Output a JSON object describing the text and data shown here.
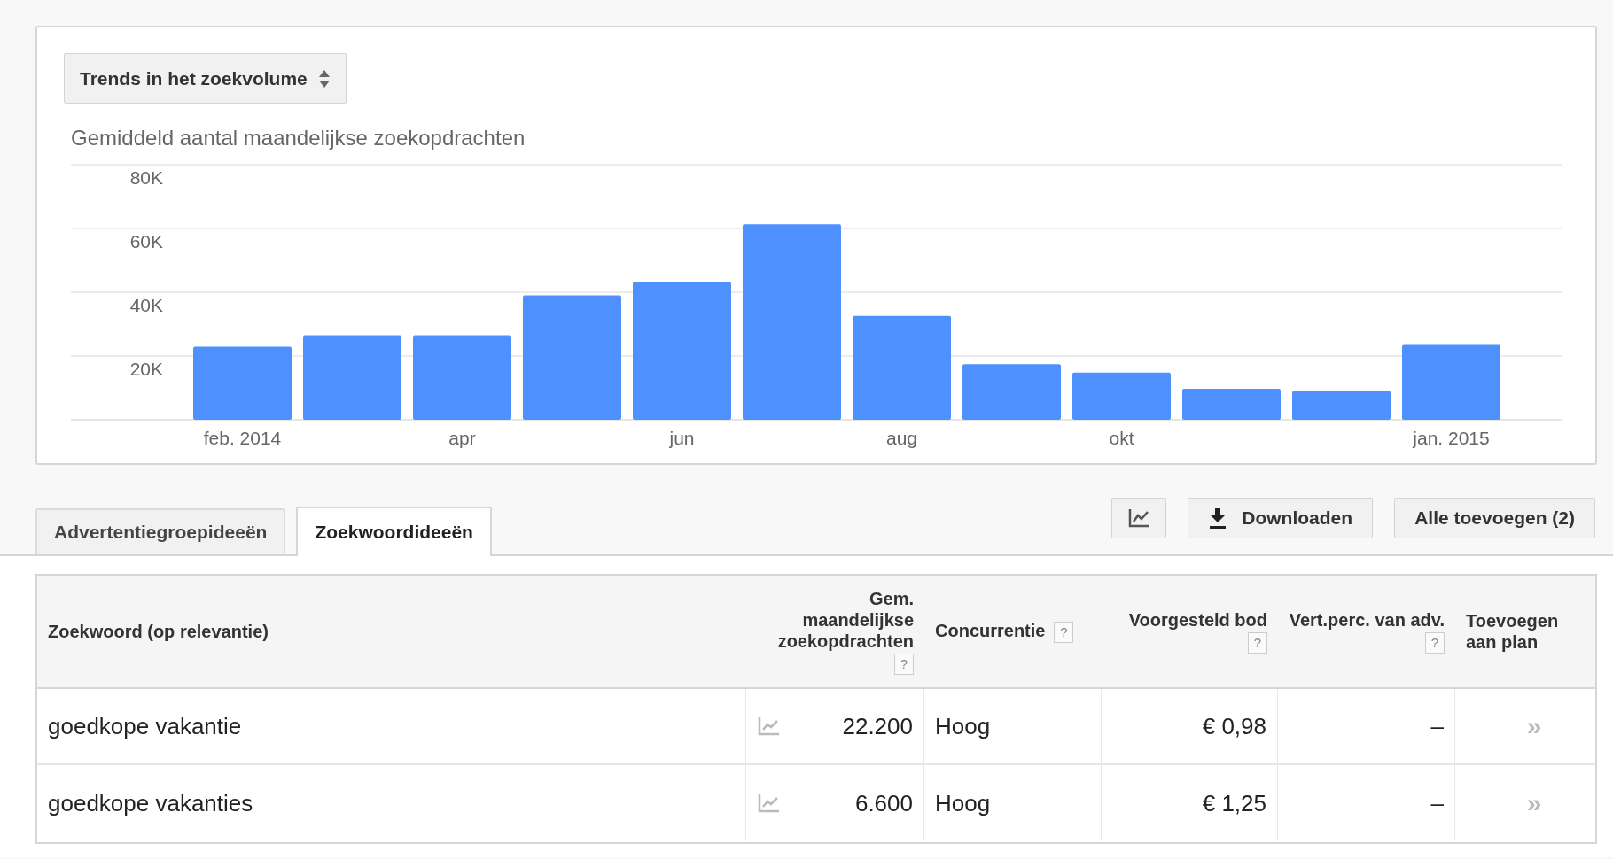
{
  "selector": {
    "label": "Trends in het zoekvolume"
  },
  "chart": {
    "title": "Gemiddeld aantal maandelijkse zoekopdrachten",
    "chart_data": {
      "type": "bar",
      "grid": true,
      "categories": [
        "feb. 2014",
        null,
        "apr",
        null,
        "jun",
        null,
        "aug",
        null,
        "okt",
        null,
        null,
        "jan. 2015"
      ],
      "series": [
        {
          "color": "#4d90fe",
          "values": [
            22900,
            26500,
            26500,
            39000,
            43200,
            61300,
            32600,
            17400,
            14800,
            9700,
            9000,
            23500
          ]
        }
      ],
      "ylim": [
        0,
        80000
      ],
      "yticks": [
        {
          "value": 20000,
          "label": "20K"
        },
        {
          "value": 40000,
          "label": "40K"
        },
        {
          "value": 60000,
          "label": "60K"
        },
        {
          "value": 80000,
          "label": "80K"
        }
      ]
    }
  },
  "tabs": [
    {
      "label": "Advertentiegroepideeën",
      "selected": false
    },
    {
      "label": "Zoekwoordideeën",
      "selected": true
    }
  ],
  "toolbar": [
    {
      "kind": "chart"
    },
    {
      "kind": "download",
      "label": "Downloaden"
    },
    {
      "kind": "text",
      "label": "Alle toevoegen (2)"
    }
  ],
  "table": {
    "columns": [
      {
        "label": "Zoekwoord (op relevantie)"
      },
      {
        "label": "Gem. maandelijkse zoekopdrachten",
        "help": "?"
      },
      {
        "label": "Concurrentie",
        "help": "?"
      },
      {
        "label": "Voorgesteld bod",
        "help": "?"
      },
      {
        "label": "Vert.perc. van adv.",
        "help": "?"
      },
      {
        "label": "Toevoegen aan plan"
      }
    ],
    "rows": [
      {
        "keyword": "goedkope vakantie",
        "volume": "22.200",
        "competition": "Hoog",
        "bid": "€ 0,98",
        "share": "–",
        "add": "»"
      },
      {
        "keyword": "goedkope vakanties",
        "volume": "6.600",
        "competition": "Hoog",
        "bid": "€ 1,25",
        "share": "–",
        "add": "»"
      }
    ]
  }
}
